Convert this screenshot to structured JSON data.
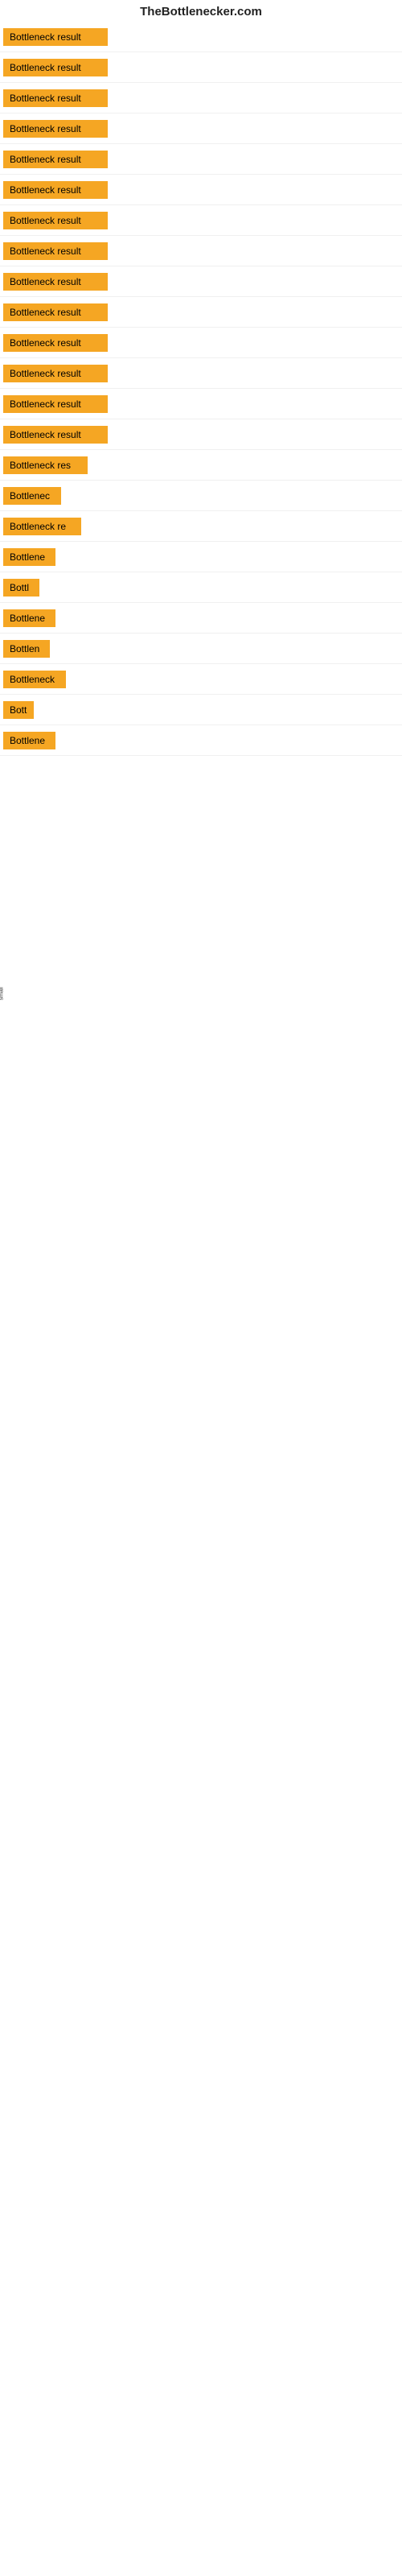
{
  "site_title": "TheBottlenecker.com",
  "rows": [
    {
      "label": "Bottleneck result",
      "width": 130
    },
    {
      "label": "Bottleneck result",
      "width": 130
    },
    {
      "label": "Bottleneck result",
      "width": 130
    },
    {
      "label": "Bottleneck result",
      "width": 130
    },
    {
      "label": "Bottleneck result",
      "width": 130
    },
    {
      "label": "Bottleneck result",
      "width": 130
    },
    {
      "label": "Bottleneck result",
      "width": 130
    },
    {
      "label": "Bottleneck result",
      "width": 130
    },
    {
      "label": "Bottleneck result",
      "width": 130
    },
    {
      "label": "Bottleneck result",
      "width": 130
    },
    {
      "label": "Bottleneck result",
      "width": 130
    },
    {
      "label": "Bottleneck result",
      "width": 130
    },
    {
      "label": "Bottleneck result",
      "width": 130
    },
    {
      "label": "Bottleneck result",
      "width": 130
    },
    {
      "label": "Bottleneck res",
      "width": 105
    },
    {
      "label": "Bottlenec",
      "width": 72
    },
    {
      "label": "Bottleneck re",
      "width": 97
    },
    {
      "label": "Bottlene",
      "width": 65
    },
    {
      "label": "Bottl",
      "width": 45
    },
    {
      "label": "Bottlene",
      "width": 65
    },
    {
      "label": "Bottlen",
      "width": 58
    },
    {
      "label": "Bottleneck",
      "width": 78
    },
    {
      "label": "Bott",
      "width": 38
    },
    {
      "label": "Bottlene",
      "width": 65
    }
  ],
  "small_label": "small"
}
